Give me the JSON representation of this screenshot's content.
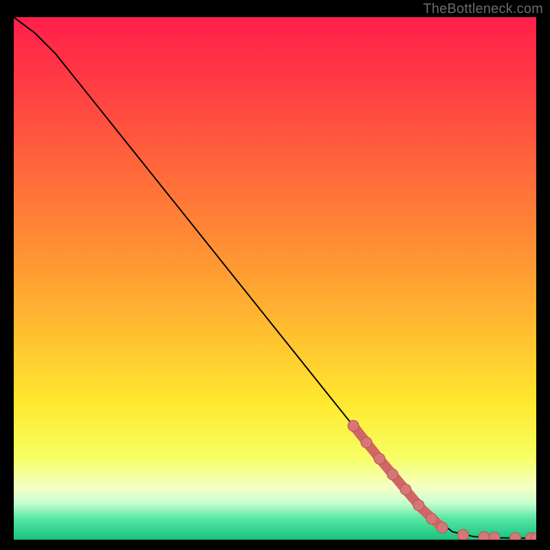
{
  "watermark": "TheBottleneck.com",
  "chart_data": {
    "type": "line",
    "title": "",
    "xlabel": "",
    "ylabel": "",
    "xlim": [
      0,
      100
    ],
    "ylim": [
      0,
      100
    ],
    "gradient_stops": [
      {
        "offset": 0.0,
        "color": "#ff1f4b"
      },
      {
        "offset": 0.12,
        "color": "#ff3a44"
      },
      {
        "offset": 0.3,
        "color": "#ff6a3a"
      },
      {
        "offset": 0.48,
        "color": "#ff9a33"
      },
      {
        "offset": 0.62,
        "color": "#ffc430"
      },
      {
        "offset": 0.74,
        "color": "#ffe92f"
      },
      {
        "offset": 0.84,
        "color": "#f7ff62"
      },
      {
        "offset": 0.9,
        "color": "#f5ffc5"
      },
      {
        "offset": 0.93,
        "color": "#c6ffcf"
      },
      {
        "offset": 0.96,
        "color": "#57e6a3"
      },
      {
        "offset": 1.0,
        "color": "#18c27e"
      }
    ],
    "curve": [
      {
        "x": 0,
        "y": 100
      },
      {
        "x": 4,
        "y": 97
      },
      {
        "x": 8,
        "y": 93
      },
      {
        "x": 12,
        "y": 88
      },
      {
        "x": 20,
        "y": 78
      },
      {
        "x": 30,
        "y": 65.5
      },
      {
        "x": 40,
        "y": 53
      },
      {
        "x": 50,
        "y": 40.5
      },
      {
        "x": 60,
        "y": 28
      },
      {
        "x": 70,
        "y": 15.5
      },
      {
        "x": 78,
        "y": 6
      },
      {
        "x": 84,
        "y": 1.5
      },
      {
        "x": 88,
        "y": 0.6
      },
      {
        "x": 92,
        "y": 0.4
      },
      {
        "x": 96,
        "y": 0.3
      },
      {
        "x": 100,
        "y": 0.3
      }
    ],
    "thick_segments": [
      {
        "x1": 65,
        "y1": 21.8,
        "x2": 70,
        "y2": 15.5
      },
      {
        "x1": 70,
        "y1": 15.5,
        "x2": 78,
        "y2": 6
      },
      {
        "x1": 78,
        "y1": 6,
        "x2": 82,
        "y2": 2.3
      }
    ],
    "points": [
      {
        "x": 65,
        "y": 21.8
      },
      {
        "x": 67.5,
        "y": 18.6
      },
      {
        "x": 70,
        "y": 15.5
      },
      {
        "x": 72.5,
        "y": 12.5
      },
      {
        "x": 75,
        "y": 9.6
      },
      {
        "x": 77.5,
        "y": 6.6
      },
      {
        "x": 80,
        "y": 4.0
      },
      {
        "x": 82,
        "y": 2.3
      },
      {
        "x": 86,
        "y": 0.9
      },
      {
        "x": 90,
        "y": 0.5
      },
      {
        "x": 92,
        "y": 0.4
      },
      {
        "x": 96,
        "y": 0.3
      },
      {
        "x": 99,
        "y": 0.3
      },
      {
        "x": 100,
        "y": 0.3
      }
    ],
    "colors": {
      "line": "#000000",
      "thick_line": "#d26666",
      "point_fill": "#d77676",
      "point_stroke": "#b55454"
    }
  }
}
